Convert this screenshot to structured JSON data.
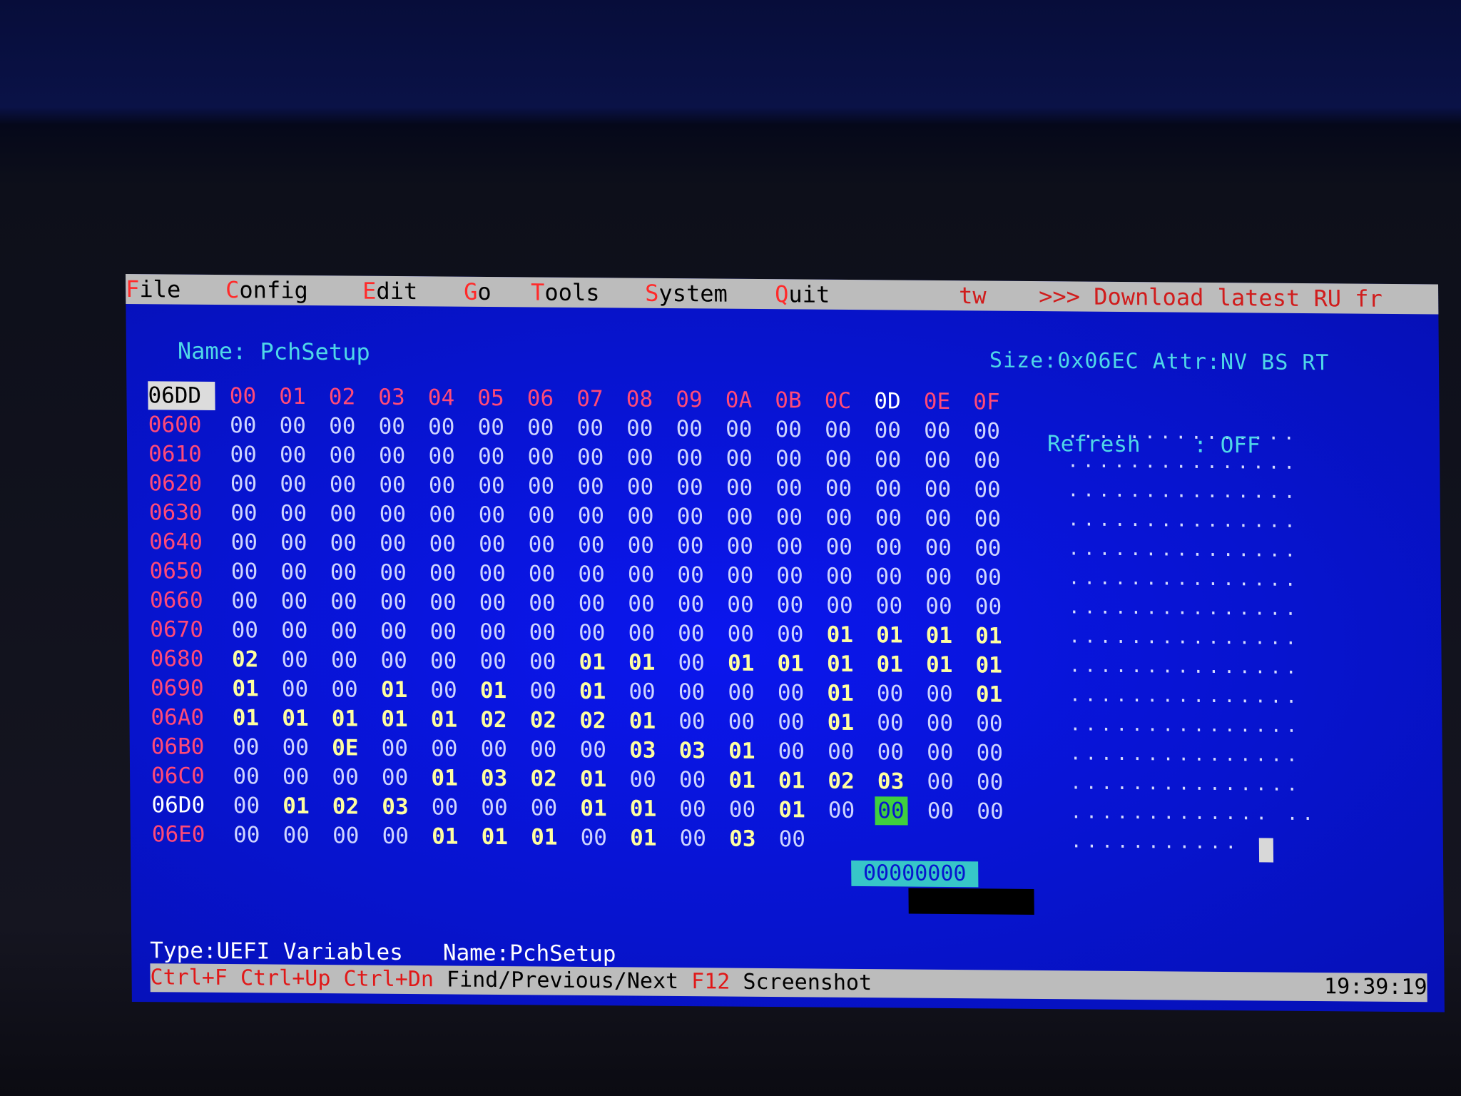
{
  "menu": {
    "items": [
      {
        "hot": "F",
        "rest": "ile"
      },
      {
        "hot": "C",
        "rest": "onfig"
      },
      {
        "hot": "E",
        "rest": "dit"
      },
      {
        "hot": "G",
        "rest": "o"
      },
      {
        "hot": "T",
        "rest": "ools"
      },
      {
        "hot": "S",
        "rest": "ystem"
      },
      {
        "hot": "Q",
        "rest": "uit"
      }
    ],
    "lang": "tw",
    "promo": ">>> Download latest RU fr"
  },
  "header": {
    "name_label": "Name: PchSetup",
    "size_attr": "Size:0x06EC Attr:NV BS RT"
  },
  "hex": {
    "corner": "06DD",
    "columns": [
      "00",
      "01",
      "02",
      "03",
      "04",
      "05",
      "06",
      "07",
      "08",
      "09",
      "0A",
      "0B",
      "0C",
      "0D",
      "0E",
      "0F"
    ],
    "rows": [
      {
        "addr": "0600",
        "bytes": [
          "00",
          "00",
          "00",
          "00",
          "00",
          "00",
          "00",
          "00",
          "00",
          "00",
          "00",
          "00",
          "00",
          "00",
          "00",
          "00"
        ],
        "ascii": "..............."
      },
      {
        "addr": "0610",
        "bytes": [
          "00",
          "00",
          "00",
          "00",
          "00",
          "00",
          "00",
          "00",
          "00",
          "00",
          "00",
          "00",
          "00",
          "00",
          "00",
          "00"
        ],
        "ascii": "..............."
      },
      {
        "addr": "0620",
        "bytes": [
          "00",
          "00",
          "00",
          "00",
          "00",
          "00",
          "00",
          "00",
          "00",
          "00",
          "00",
          "00",
          "00",
          "00",
          "00",
          "00"
        ],
        "ascii": "..............."
      },
      {
        "addr": "0630",
        "bytes": [
          "00",
          "00",
          "00",
          "00",
          "00",
          "00",
          "00",
          "00",
          "00",
          "00",
          "00",
          "00",
          "00",
          "00",
          "00",
          "00"
        ],
        "ascii": "..............."
      },
      {
        "addr": "0640",
        "bytes": [
          "00",
          "00",
          "00",
          "00",
          "00",
          "00",
          "00",
          "00",
          "00",
          "00",
          "00",
          "00",
          "00",
          "00",
          "00",
          "00"
        ],
        "ascii": "..............."
      },
      {
        "addr": "0650",
        "bytes": [
          "00",
          "00",
          "00",
          "00",
          "00",
          "00",
          "00",
          "00",
          "00",
          "00",
          "00",
          "00",
          "00",
          "00",
          "00",
          "00"
        ],
        "ascii": "..............."
      },
      {
        "addr": "0660",
        "bytes": [
          "00",
          "00",
          "00",
          "00",
          "00",
          "00",
          "00",
          "00",
          "00",
          "00",
          "00",
          "00",
          "00",
          "00",
          "00",
          "00"
        ],
        "ascii": "..............."
      },
      {
        "addr": "0670",
        "bytes": [
          "00",
          "00",
          "00",
          "00",
          "00",
          "00",
          "00",
          "00",
          "00",
          "00",
          "00",
          "00",
          "01",
          "01",
          "01",
          "01"
        ],
        "ascii": "..............."
      },
      {
        "addr": "0680",
        "bytes": [
          "02",
          "00",
          "00",
          "00",
          "00",
          "00",
          "00",
          "01",
          "01",
          "00",
          "01",
          "01",
          "01",
          "01",
          "01",
          "01"
        ],
        "ascii": "..............."
      },
      {
        "addr": "0690",
        "bytes": [
          "01",
          "00",
          "00",
          "01",
          "00",
          "01",
          "00",
          "01",
          "00",
          "00",
          "00",
          "00",
          "01",
          "00",
          "00",
          "01"
        ],
        "ascii": "..............."
      },
      {
        "addr": "06A0",
        "bytes": [
          "01",
          "01",
          "01",
          "01",
          "01",
          "02",
          "02",
          "02",
          "01",
          "00",
          "00",
          "00",
          "01",
          "00",
          "00",
          "00"
        ],
        "ascii": "..............."
      },
      {
        "addr": "06B0",
        "bytes": [
          "00",
          "00",
          "0E",
          "00",
          "00",
          "00",
          "00",
          "00",
          "03",
          "03",
          "01",
          "00",
          "00",
          "00",
          "00",
          "00"
        ],
        "ascii": "..............."
      },
      {
        "addr": "06C0",
        "bytes": [
          "00",
          "00",
          "00",
          "00",
          "01",
          "03",
          "02",
          "01",
          "00",
          "00",
          "01",
          "01",
          "02",
          "03",
          "00",
          "00"
        ],
        "ascii": "..............."
      },
      {
        "addr": "06D0",
        "bytes": [
          "00",
          "01",
          "02",
          "03",
          "00",
          "00",
          "00",
          "01",
          "01",
          "00",
          "00",
          "01",
          "00",
          "00",
          "00",
          "00"
        ],
        "ascii": ".............  .."
      },
      {
        "addr": "06E0",
        "bytes": [
          "00",
          "00",
          "00",
          "00",
          "01",
          "01",
          "01",
          "00",
          "01",
          "00",
          "03",
          "00"
        ],
        "ascii": "..........."
      }
    ],
    "edit_value": "00000000"
  },
  "refresh": {
    "label": "Refresh",
    "value": "OFF"
  },
  "status": "Type:UEFI Variables   Name:PchSetup",
  "bottom": {
    "hotkeys": "Ctrl+F Ctrl+Up Ctrl+Dn",
    "hotkeys_desc": "Find/Previous/Next",
    "f12": "F12",
    "f12_desc": "Screenshot",
    "clock": "19:39:19"
  }
}
